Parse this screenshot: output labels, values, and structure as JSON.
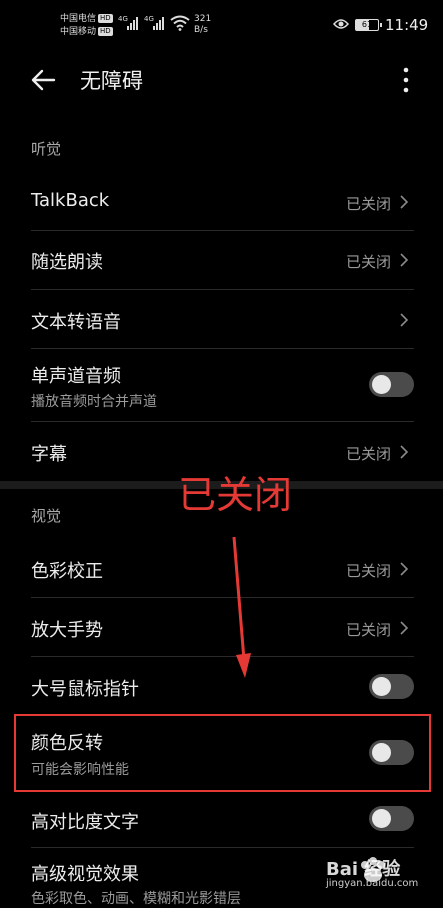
{
  "status_bar": {
    "carrier1": "中国电信",
    "carrier2": "中国移动",
    "hd_badge": "HD",
    "net_type": "4G",
    "speed_value": "321",
    "speed_unit": "B/s",
    "battery": "61",
    "battery_level": 0.61,
    "time": "11:49"
  },
  "app_bar": {
    "title": "无障碍"
  },
  "sections": {
    "hearing": "听觉",
    "vision": "视觉"
  },
  "rows": {
    "talkback": {
      "label": "TalkBack",
      "status": "已关闭"
    },
    "select_to_speak": {
      "label": "随选朗读",
      "status": "已关闭"
    },
    "tts": {
      "label": "文本转语音"
    },
    "mono_audio": {
      "label": "单声道音频",
      "sub": "播放音频时合并声道",
      "on": false
    },
    "captions": {
      "label": "字幕",
      "status": "已关闭"
    },
    "color_correction": {
      "label": "色彩校正",
      "status": "已关闭"
    },
    "magnification": {
      "label": "放大手势",
      "status": "已关闭"
    },
    "large_pointer": {
      "label": "大号鼠标指针",
      "on": false
    },
    "color_inversion": {
      "label": "颜色反转",
      "sub": "可能会影响性能",
      "on": false
    },
    "high_contrast": {
      "label": "高对比度文字",
      "on": false
    },
    "advanced_visual": {
      "label": "高级视觉效果",
      "sub": "色彩取色、动画、模糊和光影错层"
    }
  },
  "annotation": {
    "text": "已关闭",
    "color": "#e53935"
  },
  "watermark": {
    "text": "Bai 经验",
    "url": "jingyan.baidu.com"
  }
}
